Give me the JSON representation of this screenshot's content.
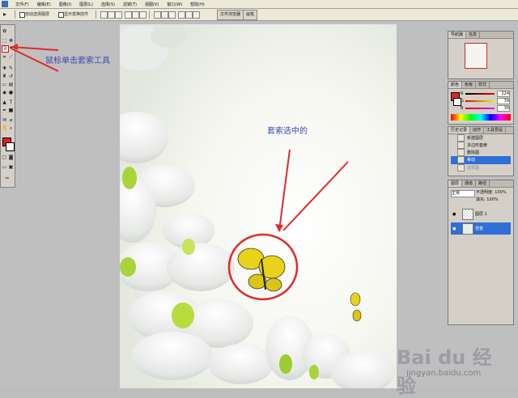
{
  "menubar": {
    "items": [
      "文件(F)",
      "编辑(E)",
      "图像(I)",
      "图层(L)",
      "选择(S)",
      "滤镜(T)",
      "视图(V)",
      "窗口(W)",
      "帮助(H)"
    ]
  },
  "options_bar": {
    "checkbox1": "自动选择图层",
    "checkbox2": "显示变换控件",
    "tab1": "文件浏览器",
    "tab2": "画笔"
  },
  "panels": {
    "navigator": {
      "tabs": [
        "导航器",
        "信息"
      ]
    },
    "color": {
      "tabs": [
        "颜色",
        "色板",
        "样式"
      ],
      "channels": [
        {
          "label": "R",
          "value": "224"
        },
        {
          "label": "G",
          "value": "39"
        },
        {
          "label": "B",
          "value": "39"
        }
      ],
      "foreground": "#e02727"
    },
    "history": {
      "tabs": [
        "历史记录",
        "动作",
        "工具预设"
      ],
      "items": [
        {
          "label": "新建图层",
          "state": "normal"
        },
        {
          "label": "多边形套索",
          "state": "normal"
        },
        {
          "label": "删除图",
          "state": "normal"
        },
        {
          "label": "移动",
          "state": "active"
        },
        {
          "label": "选择图",
          "state": "greyed"
        }
      ]
    },
    "layers": {
      "tabs": [
        "图层",
        "通道",
        "路径"
      ],
      "blend_mode": "正常",
      "opacity": "不透明度: 100%",
      "fill": "填充: 100%",
      "items": [
        {
          "name": "图层 1",
          "active": false
        },
        {
          "name": "背景",
          "active": true
        }
      ]
    }
  },
  "annotations": {
    "tool_hint": "鼠标单击套索工具",
    "selection_hint": "套索选中的",
    "arrow_color": "#e02a2a",
    "text_color": "#3a49b0"
  },
  "watermark": {
    "brand": "Bai du 经验",
    "sub": "jingyan.baidu.com"
  }
}
